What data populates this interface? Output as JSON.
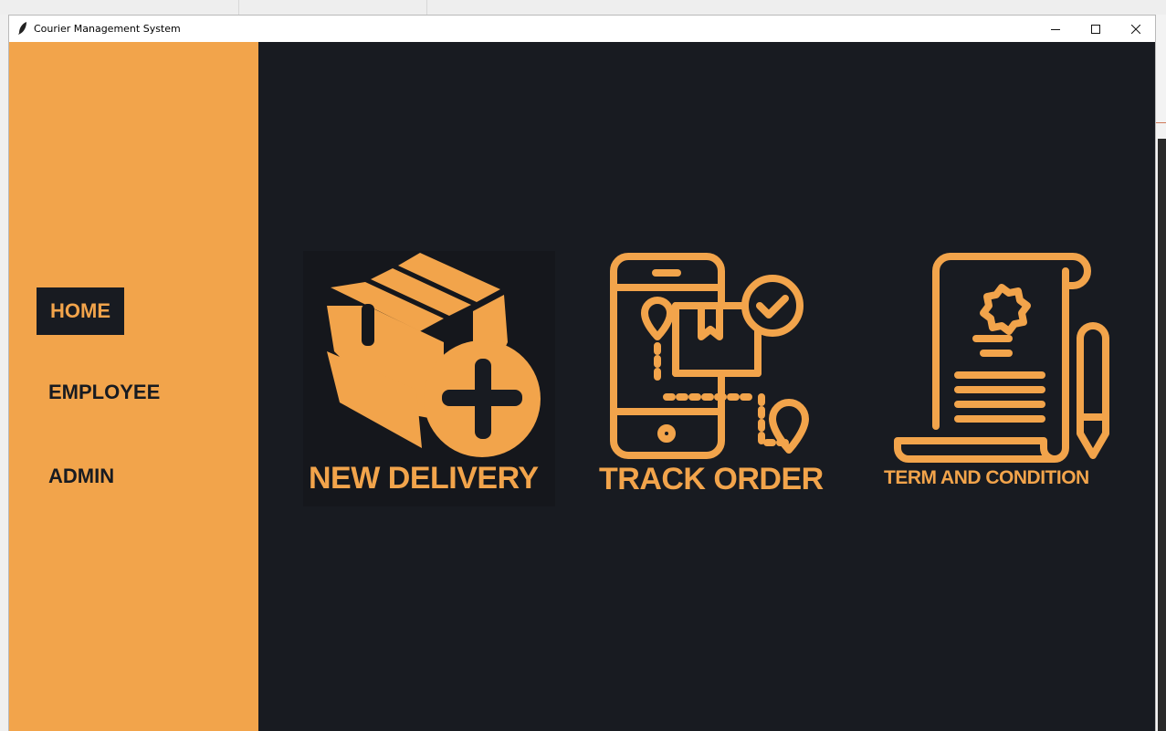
{
  "window": {
    "title": "Courier Management System",
    "controls": {
      "minimize": "–",
      "maximize": "□",
      "close": "✕"
    }
  },
  "sidebar": {
    "items": [
      {
        "label": "HOME",
        "active": true
      },
      {
        "label": "EMPLOYEE",
        "active": false
      },
      {
        "label": "ADMIN",
        "active": false
      }
    ]
  },
  "main": {
    "cards": [
      {
        "label": "NEW DELIVERY",
        "icon": "package-add-icon"
      },
      {
        "label": "TRACK ORDER",
        "icon": "phone-tracking-icon"
      },
      {
        "label": "TERM AND CONDITION",
        "icon": "certificate-scroll-icon"
      }
    ]
  },
  "colors": {
    "accent": "#f2a44b",
    "background": "#181b21",
    "titlebar": "#ffffff"
  }
}
